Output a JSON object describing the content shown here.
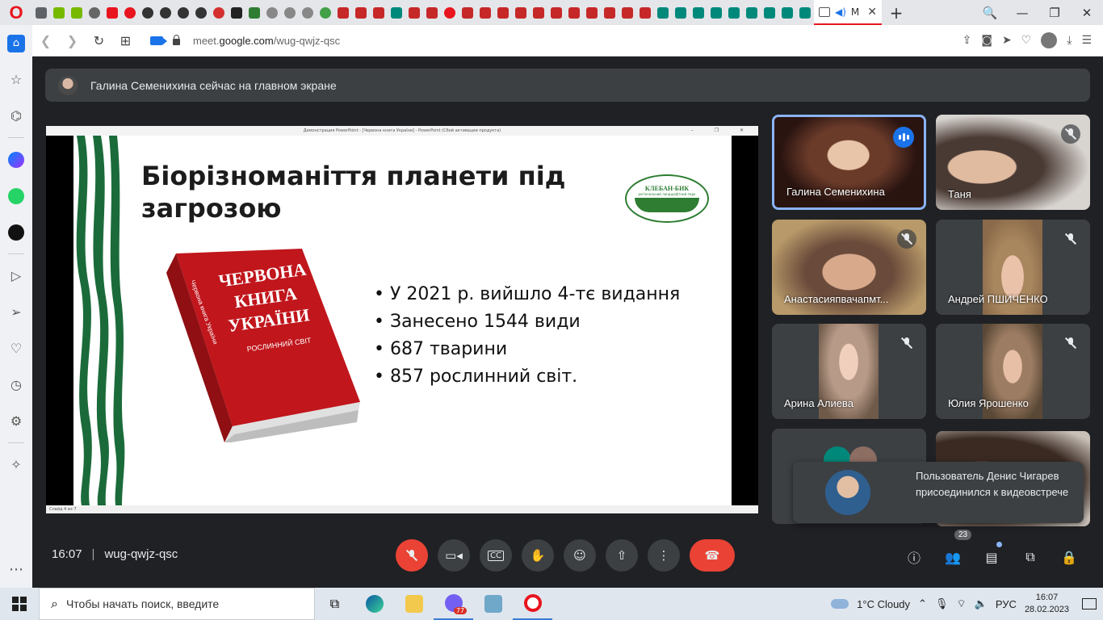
{
  "browser": {
    "active_tab": {
      "label": "М",
      "close": "✕"
    },
    "new_tab": "+",
    "window_controls": {
      "search": "🔍",
      "minimize": "—",
      "maximize": "❐",
      "close": "✕"
    },
    "url_prefix": "meet.",
    "url_domain": "google.com",
    "url_path": "/wug-qwjz-qsc"
  },
  "meet": {
    "presenter_notice": "Галина Семенихина сейчас на главном экране",
    "meeting_time": "16:07",
    "separator": "|",
    "meeting_code": "wug-qwjz-qsc",
    "participants_count": "23",
    "participants": [
      {
        "name": "Галина Семенихина"
      },
      {
        "name": "Таня"
      },
      {
        "name": "Анастасияпвачапмт..."
      },
      {
        "name": "Андрей ПШИЧЕНКО"
      },
      {
        "name": "Арина Алиева"
      },
      {
        "name": "Юлия Ярошенко"
      }
    ],
    "toast": "Пользователь Денис Чигарев присоединился к видеовстрече"
  },
  "presentation": {
    "window_title": "Демонстрация PowerPoint - [Червона книга України] - PowerPoint (Сбой активации продукта)",
    "status": "Слайд 4 из 7",
    "title_line1": "Біорізноманіття планети під",
    "title_line2": "загрозою",
    "logo_text": "КЛЕБАН-БИК",
    "logo_sub": "регіональний ландшафтний парк",
    "book_line1": "ЧЕРВОНА",
    "book_line2": "КНИГА",
    "book_line3": "УКРАЇНИ",
    "book_sub": "РОСЛИННИЙ СВІТ",
    "book_spine": "Червона книга України",
    "bullets": [
      "• У 2021 р. вийшло 4-тє видання",
      "• Занесено 1544 види",
      "•  687 тварини",
      "•  857 рослинний світ."
    ]
  },
  "taskbar": {
    "search_placeholder": "Чтобы начать поиск, введите",
    "viber_badge": "77",
    "weather": "1°C  Cloudy",
    "lang": "РУС",
    "time": "16:07",
    "date": "28.02.2023"
  },
  "colors": {
    "meet_bg": "#202124",
    "tile_bg": "#3c4043",
    "hangup_red": "#ea4335",
    "active_border": "#8ab4f8",
    "slide_green": "#1b6b3a",
    "book_red": "#c0161c"
  }
}
